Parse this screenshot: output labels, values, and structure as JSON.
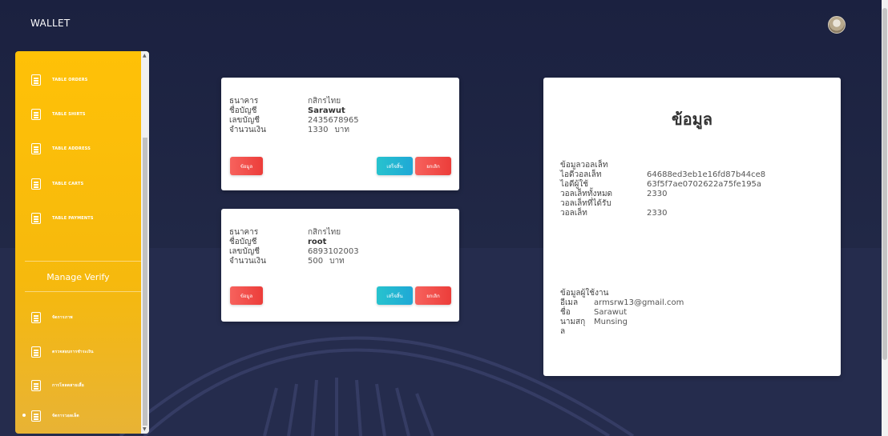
{
  "header": {
    "brand": "WALLET"
  },
  "sidebar": {
    "items": [
      {
        "label": "TABLE ORDERS",
        "icon": "clipboard-icon"
      },
      {
        "label": "TABLE SHIRTS",
        "icon": "calendar-check-icon"
      },
      {
        "label": "TABLE ADDRESS",
        "icon": "list-icon"
      },
      {
        "label": "TABLE CARTS",
        "icon": "list-icon"
      },
      {
        "label": "TABLE PAYMENTS",
        "icon": "list-icon"
      }
    ],
    "section_title": "Manage Verify",
    "verify_items": [
      {
        "label": "จัดการภาพ",
        "icon": "list-icon"
      },
      {
        "label": "ตรวจสอบการชำระเงิน",
        "icon": "list-icon"
      },
      {
        "label": "การโหลดสายเสื้อ",
        "icon": "list-icon"
      },
      {
        "label": "จัดการวอลเล็ต",
        "icon": "list-icon"
      }
    ]
  },
  "cards": [
    {
      "bank_label": "ธนาคาร",
      "bank": "กสิกรไทย",
      "name_label": "ชื่อบัญชี",
      "name": "Sarawut",
      "number_label": "เลขบัญชี",
      "number": "2435678965",
      "amount_label": "จำนวนเงิน",
      "amount": "1330",
      "currency": "บาท",
      "btn_info": "ข้อมูล",
      "btn_done": "เสร็จสิ้น",
      "btn_cancel": "ยกเลิก"
    },
    {
      "bank_label": "ธนาคาร",
      "bank": "กสิกรไทย",
      "name_label": "ชื่อบัญชี",
      "name": "root",
      "number_label": "เลขบัญชี",
      "number": "6893102003",
      "amount_label": "จำนวนเงิน",
      "amount": "500",
      "currency": "บาท",
      "btn_info": "ข้อมูล",
      "btn_done": "เสร็จสิ้น",
      "btn_cancel": "ยกเลิก"
    }
  ],
  "info": {
    "title": "ข้อมูล",
    "wallet_heading": "ข้อมูลวอลเล็ท",
    "wallet_id_label": "ไอดีวอลเล็ท",
    "wallet_id": "64688ed3eb1e16fd87b44ce8",
    "user_id_label": "ไอดีผู้ใช้",
    "user_id": "63f5f7ae0702622a75fe195a",
    "total_label": "วอลเล็ททั้งหมด",
    "total": "2330",
    "received_label": "วอลเล็ทที่ได้รับ",
    "wallet_label": "วอลเล็ท",
    "wallet": "2330",
    "user_heading": "ข้อมูลผู้ใช้งาน",
    "email_label": "อีเมล",
    "email": "armsrw13@gmail.com",
    "fname_label": "ชื่อ",
    "fname": "Sarawut",
    "lname_label": "นามสกุ",
    "lname": "Munsing",
    "lname_label_wrap": "ล"
  }
}
